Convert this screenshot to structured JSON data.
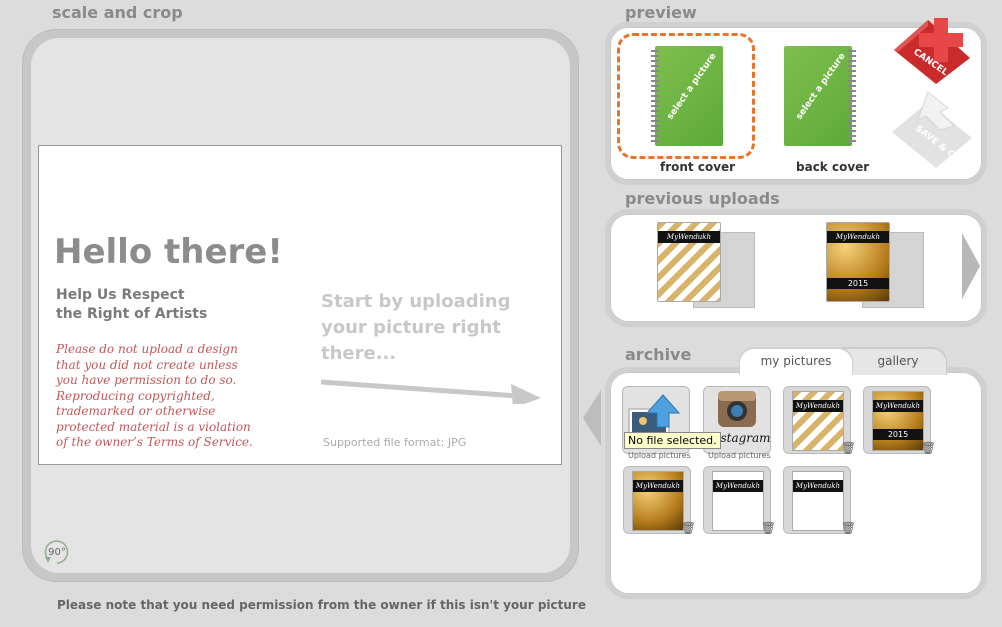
{
  "sections": {
    "scale_crop": "scale and crop",
    "preview": "preview",
    "previous_uploads": "previous uploads",
    "archive": "archive"
  },
  "intro": {
    "hello": "Hello there!",
    "respect_lines": [
      "Help Us Respect",
      "the Right of Artists"
    ],
    "warning_lines": [
      "Please do not upload a design",
      "that you did not create unless",
      "you have permission to do so.",
      "Reproducing copyrighted,",
      "trademarked or otherwise",
      "protected material is a violation",
      "of the owner’s Terms of Service."
    ],
    "start_lines": [
      "Start by uploading",
      "your picture right",
      "there..."
    ],
    "format": "Supported file format: JPG"
  },
  "rotate_label": "90°",
  "note": "Please note that you need permission from the owner if this isn't your picture",
  "preview": {
    "front_label": "select a picture",
    "back_label": "select a picture",
    "front_caption": "front cover",
    "back_caption": "back cover",
    "cancel": "CANCEL",
    "save_close": "SAVE & CLOSE"
  },
  "uploads": {
    "brand": "MyWendukh",
    "year": "2015"
  },
  "tabs": {
    "my_pictures": "my pictures",
    "gallery": "gallery"
  },
  "archive": {
    "upload_caption": "Upload pictures",
    "instagram": "Instagram",
    "instagram_caption": "Upload pictures",
    "tooltip": "No file selected.",
    "brand": "MyWendukh",
    "year": "2015"
  },
  "colors": {
    "accent_orange": "#e8742b",
    "notebook_green": "#6cb343",
    "warning_red": "#c0585a",
    "cancel_red": "#d42b2b"
  }
}
